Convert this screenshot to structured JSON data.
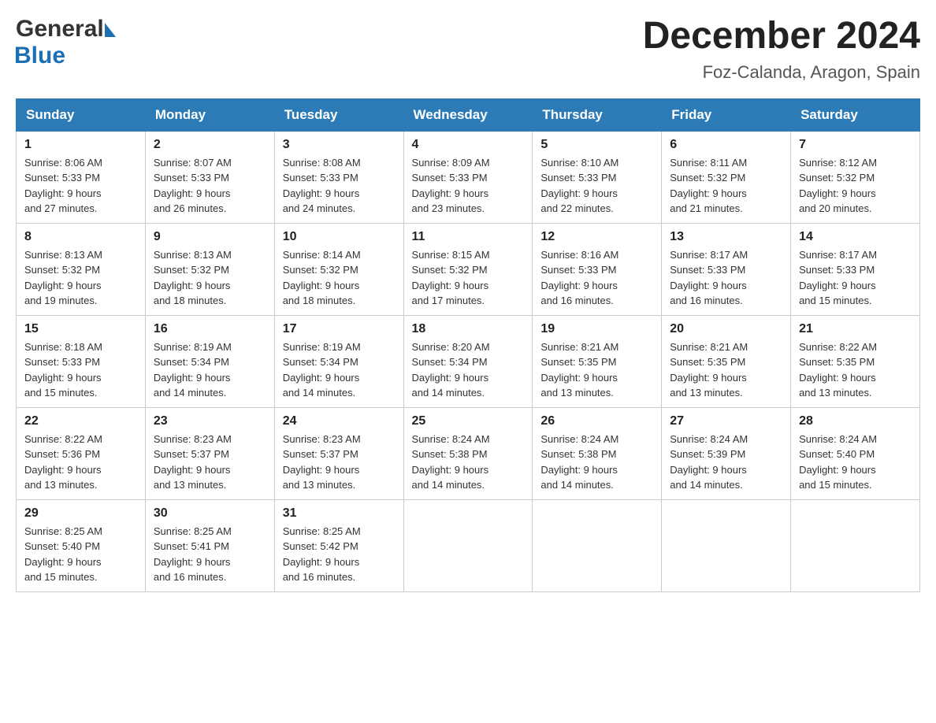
{
  "header": {
    "logo_general": "General",
    "logo_blue": "Blue",
    "month_title": "December 2024",
    "location": "Foz-Calanda, Aragon, Spain"
  },
  "days_of_week": [
    "Sunday",
    "Monday",
    "Tuesday",
    "Wednesday",
    "Thursday",
    "Friday",
    "Saturday"
  ],
  "weeks": [
    [
      {
        "day": "1",
        "sunrise": "8:06 AM",
        "sunset": "5:33 PM",
        "daylight": "9 hours and 27 minutes."
      },
      {
        "day": "2",
        "sunrise": "8:07 AM",
        "sunset": "5:33 PM",
        "daylight": "9 hours and 26 minutes."
      },
      {
        "day": "3",
        "sunrise": "8:08 AM",
        "sunset": "5:33 PM",
        "daylight": "9 hours and 24 minutes."
      },
      {
        "day": "4",
        "sunrise": "8:09 AM",
        "sunset": "5:33 PM",
        "daylight": "9 hours and 23 minutes."
      },
      {
        "day": "5",
        "sunrise": "8:10 AM",
        "sunset": "5:33 PM",
        "daylight": "9 hours and 22 minutes."
      },
      {
        "day": "6",
        "sunrise": "8:11 AM",
        "sunset": "5:32 PM",
        "daylight": "9 hours and 21 minutes."
      },
      {
        "day": "7",
        "sunrise": "8:12 AM",
        "sunset": "5:32 PM",
        "daylight": "9 hours and 20 minutes."
      }
    ],
    [
      {
        "day": "8",
        "sunrise": "8:13 AM",
        "sunset": "5:32 PM",
        "daylight": "9 hours and 19 minutes."
      },
      {
        "day": "9",
        "sunrise": "8:13 AM",
        "sunset": "5:32 PM",
        "daylight": "9 hours and 18 minutes."
      },
      {
        "day": "10",
        "sunrise": "8:14 AM",
        "sunset": "5:32 PM",
        "daylight": "9 hours and 18 minutes."
      },
      {
        "day": "11",
        "sunrise": "8:15 AM",
        "sunset": "5:32 PM",
        "daylight": "9 hours and 17 minutes."
      },
      {
        "day": "12",
        "sunrise": "8:16 AM",
        "sunset": "5:33 PM",
        "daylight": "9 hours and 16 minutes."
      },
      {
        "day": "13",
        "sunrise": "8:17 AM",
        "sunset": "5:33 PM",
        "daylight": "9 hours and 16 minutes."
      },
      {
        "day": "14",
        "sunrise": "8:17 AM",
        "sunset": "5:33 PM",
        "daylight": "9 hours and 15 minutes."
      }
    ],
    [
      {
        "day": "15",
        "sunrise": "8:18 AM",
        "sunset": "5:33 PM",
        "daylight": "9 hours and 15 minutes."
      },
      {
        "day": "16",
        "sunrise": "8:19 AM",
        "sunset": "5:34 PM",
        "daylight": "9 hours and 14 minutes."
      },
      {
        "day": "17",
        "sunrise": "8:19 AM",
        "sunset": "5:34 PM",
        "daylight": "9 hours and 14 minutes."
      },
      {
        "day": "18",
        "sunrise": "8:20 AM",
        "sunset": "5:34 PM",
        "daylight": "9 hours and 14 minutes."
      },
      {
        "day": "19",
        "sunrise": "8:21 AM",
        "sunset": "5:35 PM",
        "daylight": "9 hours and 13 minutes."
      },
      {
        "day": "20",
        "sunrise": "8:21 AM",
        "sunset": "5:35 PM",
        "daylight": "9 hours and 13 minutes."
      },
      {
        "day": "21",
        "sunrise": "8:22 AM",
        "sunset": "5:35 PM",
        "daylight": "9 hours and 13 minutes."
      }
    ],
    [
      {
        "day": "22",
        "sunrise": "8:22 AM",
        "sunset": "5:36 PM",
        "daylight": "9 hours and 13 minutes."
      },
      {
        "day": "23",
        "sunrise": "8:23 AM",
        "sunset": "5:37 PM",
        "daylight": "9 hours and 13 minutes."
      },
      {
        "day": "24",
        "sunrise": "8:23 AM",
        "sunset": "5:37 PM",
        "daylight": "9 hours and 13 minutes."
      },
      {
        "day": "25",
        "sunrise": "8:24 AM",
        "sunset": "5:38 PM",
        "daylight": "9 hours and 14 minutes."
      },
      {
        "day": "26",
        "sunrise": "8:24 AM",
        "sunset": "5:38 PM",
        "daylight": "9 hours and 14 minutes."
      },
      {
        "day": "27",
        "sunrise": "8:24 AM",
        "sunset": "5:39 PM",
        "daylight": "9 hours and 14 minutes."
      },
      {
        "day": "28",
        "sunrise": "8:24 AM",
        "sunset": "5:40 PM",
        "daylight": "9 hours and 15 minutes."
      }
    ],
    [
      {
        "day": "29",
        "sunrise": "8:25 AM",
        "sunset": "5:40 PM",
        "daylight": "9 hours and 15 minutes."
      },
      {
        "day": "30",
        "sunrise": "8:25 AM",
        "sunset": "5:41 PM",
        "daylight": "9 hours and 16 minutes."
      },
      {
        "day": "31",
        "sunrise": "8:25 AM",
        "sunset": "5:42 PM",
        "daylight": "9 hours and 16 minutes."
      },
      null,
      null,
      null,
      null
    ]
  ],
  "labels": {
    "sunrise": "Sunrise:",
    "sunset": "Sunset:",
    "daylight": "Daylight:"
  }
}
